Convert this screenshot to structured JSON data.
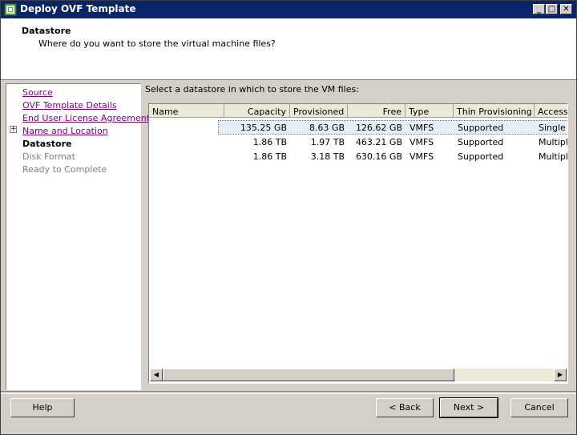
{
  "window": {
    "title": "Deploy OVF Template",
    "minimize_label": "_",
    "maximize_label": "□",
    "close_label": "✕"
  },
  "header": {
    "title": "Datastore",
    "subtitle": "Where do you want to store the virtual machine files?"
  },
  "steps": [
    {
      "label": "Source",
      "state": "link"
    },
    {
      "label": "OVF Template Details",
      "state": "link"
    },
    {
      "label": "End User License Agreement",
      "state": "link"
    },
    {
      "label": "Name and Location",
      "state": "link"
    },
    {
      "label": "Datastore",
      "state": "active"
    },
    {
      "label": "Disk Format",
      "state": "disabled"
    },
    {
      "label": "Ready to Complete",
      "state": "disabled"
    }
  ],
  "prompt": "Select a datastore in which to store the VM files:",
  "table": {
    "columns": [
      "Name",
      "Capacity",
      "Provisioned",
      "Free",
      "Type",
      "Thin Provisioning",
      "Access"
    ],
    "rows": [
      {
        "name": "",
        "capacity": "135.25 GB",
        "provisioned": "8.63 GB",
        "free": "126.62 GB",
        "type": "VMFS",
        "thin": "Supported",
        "access": "Single h"
      },
      {
        "name": "",
        "capacity": "1.86 TB",
        "provisioned": "1.97 TB",
        "free": "463.21 GB",
        "type": "VMFS",
        "thin": "Supported",
        "access": "Multiple"
      },
      {
        "name": "",
        "capacity": "1.86 TB",
        "provisioned": "3.18 TB",
        "free": "630.16 GB",
        "type": "VMFS",
        "thin": "Supported",
        "access": "Multiple"
      }
    ]
  },
  "scroll": {
    "left_icon": "◀",
    "right_icon": "▶"
  },
  "buttons": {
    "help": "Help",
    "back": "< Back",
    "next": "Next >",
    "cancel": "Cancel"
  },
  "icons": {
    "app": "vsphere-app-icon",
    "expand": "plus-expand-icon"
  },
  "colors": {
    "titlebar": "#0a246a",
    "selected_row": "#e8eef6",
    "link_visited": "#800080"
  }
}
